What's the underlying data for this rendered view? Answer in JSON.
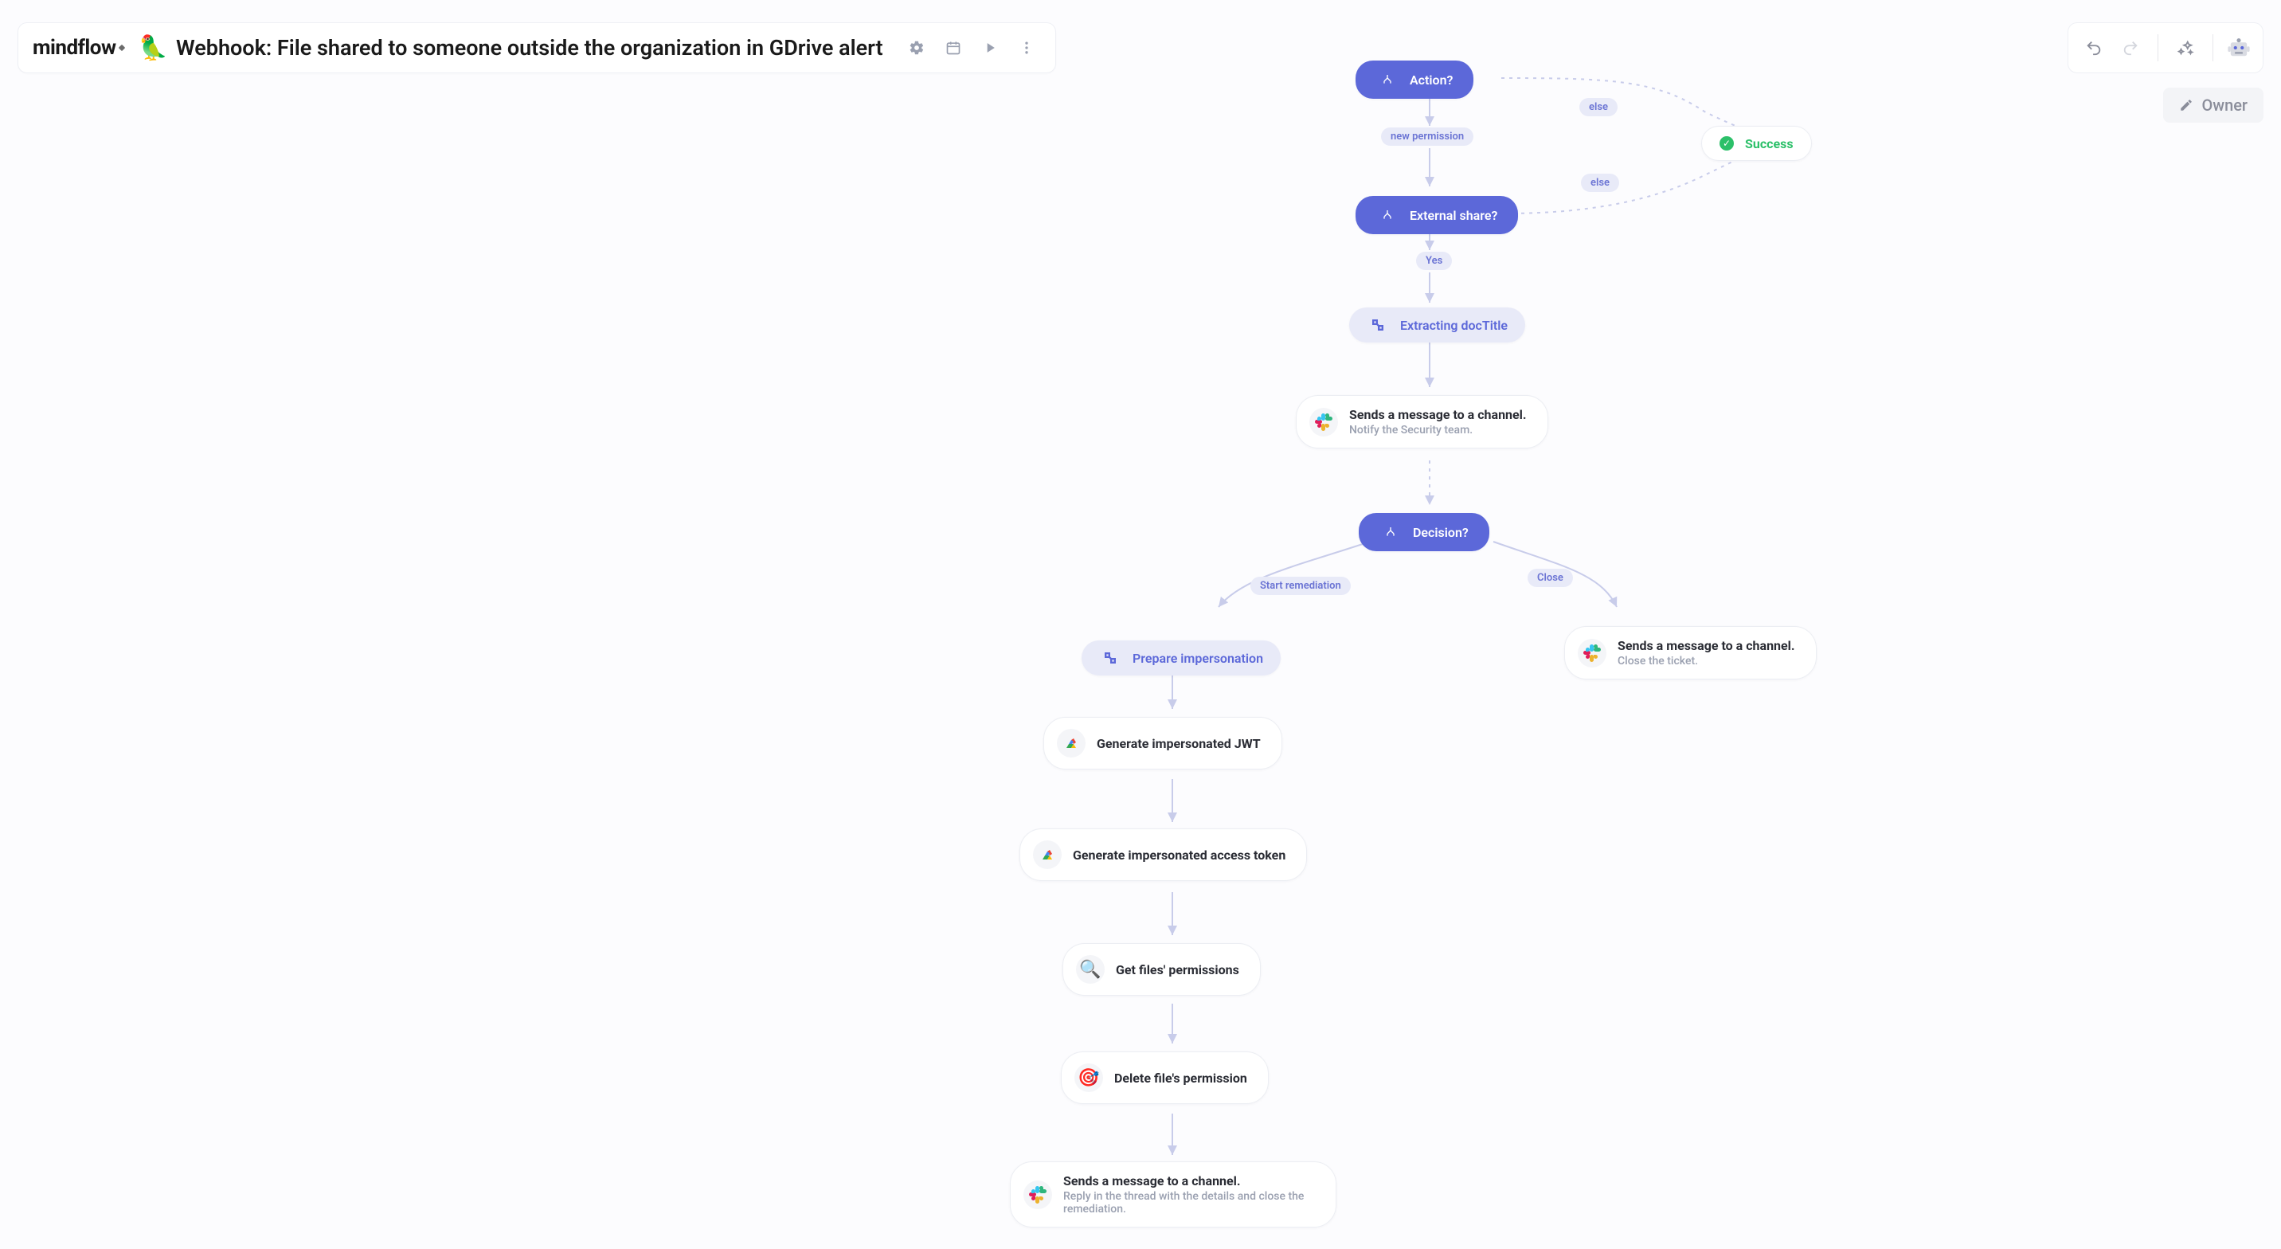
{
  "header": {
    "logo": "mindflow",
    "emoji": "🦜",
    "title": "Webhook: File shared to someone outside the organization in GDrive alert"
  },
  "owner_chip": "Owner",
  "edge_labels": {
    "else1": "else",
    "new_permission": "new permission",
    "else2": "else",
    "yes": "Yes",
    "start_remediation": "Start remediation",
    "close": "Close"
  },
  "nodes": {
    "action": {
      "title": "Action?"
    },
    "success": {
      "title": "Success"
    },
    "external": {
      "title": "External share?"
    },
    "extracting": {
      "title": "Extracting docTitle"
    },
    "slack_notify": {
      "title": "Sends a message to a channel.",
      "sub": "Notify the Security team."
    },
    "decision": {
      "title": "Decision?"
    },
    "prepare": {
      "title": "Prepare impersonation"
    },
    "jwt": {
      "title": "Generate impersonated JWT"
    },
    "token": {
      "title": "Generate impersonated access token"
    },
    "perms": {
      "title": "Get files' permissions"
    },
    "delete": {
      "title": "Delete file's permission"
    },
    "slack_reply": {
      "title": "Sends a message to a channel.",
      "sub": "Reply in the thread with the details and close the remediation."
    },
    "slack_close": {
      "title": "Sends a message to a channel.",
      "sub": "Close the ticket."
    }
  }
}
